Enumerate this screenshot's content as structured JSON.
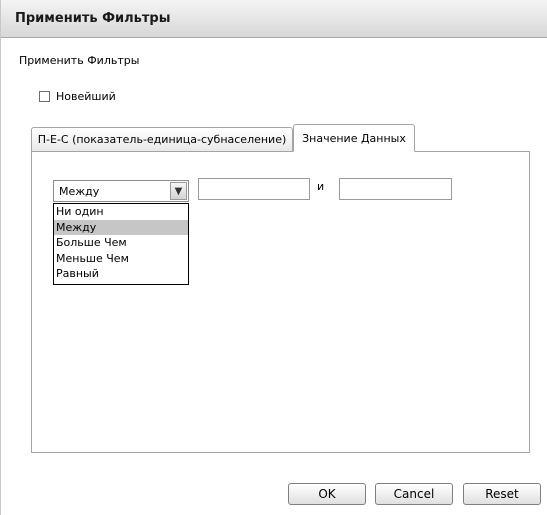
{
  "window": {
    "title": "Применить Фильтры"
  },
  "dialog": {
    "subtitle": "Применить Фильтры",
    "checkbox": {
      "label": "Новейший",
      "checked": false
    }
  },
  "tabs": [
    {
      "label": "П-Е-С (показатель-единица-субнаселение)",
      "active": false
    },
    {
      "label": "Значение Данных",
      "active": true
    }
  ],
  "filter": {
    "selected": "Между",
    "options": [
      "Ни один",
      "Между",
      "Больше Чем",
      "Меньше Чем",
      "Равный"
    ],
    "from_value": "",
    "and_label": "и",
    "to_value": ""
  },
  "buttons": {
    "ok": "OK",
    "cancel": "Cancel",
    "reset": "Reset"
  },
  "colors": {
    "selected_option_bg": "#c6c6c6",
    "title_bar": "#d7d7d7"
  }
}
